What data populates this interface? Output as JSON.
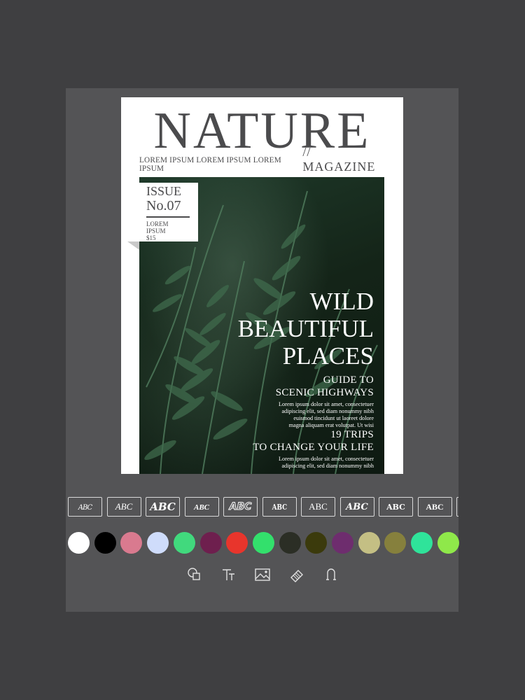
{
  "cover": {
    "title": "NATURE",
    "subline_left": "LOREM IPSUM LOREM IPSUM LOREM IPSUM",
    "subline_right": "// MAGAZINE",
    "issue": {
      "line1": "ISSUE",
      "line2": "No.07",
      "line3": "LOREM",
      "line4": "IPSUM",
      "line5": "$15"
    },
    "headline": [
      "WILD",
      "BEAUTIFUL",
      "PLACES"
    ],
    "section1": {
      "heading": [
        "GUIDE TO",
        "SCENIC HIGHWAYS"
      ],
      "body": [
        "Lorem ipsum dolor sit amet, consectetuer",
        "adipiscing elit, sed diam nonummy nibh",
        "euismod tincidunt ut laoreet dolore",
        "magna aliquam erat volutpat. Ut wisi"
      ]
    },
    "section2": {
      "heading": [
        "19 TRIPS",
        "TO CHANGE YOUR LIFE"
      ],
      "body": [
        "Lorem ipsum dolor sit amet, consectetuer",
        "adipiscing elit, sed diam nonummy nibh"
      ]
    }
  },
  "font_styles": [
    {
      "label": "ABC",
      "style": "script-thin"
    },
    {
      "label": "ABC",
      "style": "italic-light"
    },
    {
      "label": "ABC",
      "style": "script-bold"
    },
    {
      "label": "ABC",
      "style": "brush"
    },
    {
      "label": "ABC",
      "style": "outline-bold"
    },
    {
      "label": "ABC",
      "style": "blackletter"
    },
    {
      "label": "ABC",
      "style": "serif-light"
    },
    {
      "label": "ABC",
      "style": "decorative"
    },
    {
      "label": "ABC",
      "style": "slab-heavy"
    },
    {
      "label": "ABC",
      "style": "serif-heavy"
    }
  ],
  "colors": [
    "#ffffff",
    "#000000",
    "#d97a8f",
    "#cfdcfb",
    "#41d97d",
    "#6e1f4e",
    "#e8352c",
    "#33e06c",
    "#2b2e25",
    "#3b3a0c",
    "#6e2d6e",
    "#c4bf84",
    "#86803d",
    "#2fe39a",
    "#8fe84a"
  ],
  "tools": [
    {
      "name": "shapes-tool"
    },
    {
      "name": "text-tool"
    },
    {
      "name": "image-tool"
    },
    {
      "name": "eraser-tool"
    },
    {
      "name": "magnet-tool"
    }
  ]
}
